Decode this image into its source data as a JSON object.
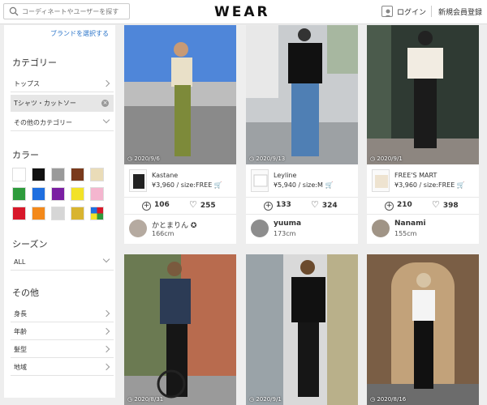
{
  "header": {
    "search_placeholder": "コーディネートやユーザーを探す",
    "logo": "WEAR",
    "login": "ログイン",
    "register": "新規会員登録"
  },
  "sidebar": {
    "brand_link": "ブランドを選択する",
    "category_title": "カテゴリー",
    "categories": [
      "トップス",
      "Tシャツ・カットソー",
      "その他のカテゴリー"
    ],
    "color_title": "カラー",
    "colors": [
      "#ffffff",
      "#111111",
      "#9a9a9a",
      "#7a3a1c",
      "#eadcb8",
      "#2e9b3c",
      "#1f6fe0",
      "#7a1fa2",
      "#f2e228",
      "#f4b6cf",
      "#d8182a",
      "#f3891b",
      "#d6d6d6",
      "#d8b430",
      "multi"
    ],
    "season_title": "シーズン",
    "season_value": "ALL",
    "other_title": "その他",
    "others": [
      "身長",
      "年齢",
      "髪型",
      "地域"
    ]
  },
  "cards": [
    {
      "date": "2020/9/6",
      "brand": "Kastane",
      "price": "¥3,960 / size:FREE",
      "plus": "106",
      "likes": "255",
      "user": "かとまりん",
      "height": "166cm"
    },
    {
      "date": "2020/9/13",
      "brand": "Leyline",
      "price": "¥5,940 / size:M",
      "plus": "133",
      "likes": "324",
      "user": "yuuma",
      "height": "173cm"
    },
    {
      "date": "2020/9/1",
      "brand": "FREE'S MART",
      "price": "¥3,960 / size:FREE",
      "plus": "210",
      "likes": "398",
      "user": "Nanami",
      "height": "155cm"
    },
    {
      "date": "2020/8/31"
    },
    {
      "date": "2020/9/1"
    },
    {
      "date": "2020/8/16"
    }
  ]
}
